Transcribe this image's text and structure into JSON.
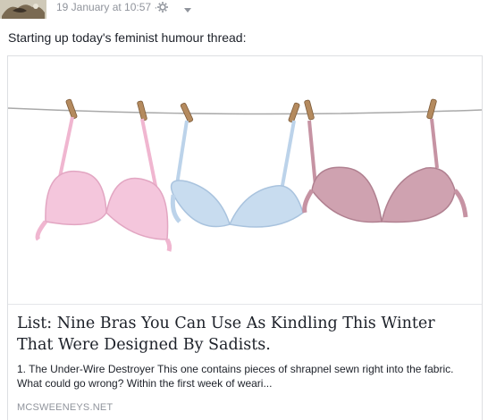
{
  "post": {
    "timestamp": "19 January at 10:57 ·",
    "text": "Starting up today's feminist humour thread:",
    "privacy_icon": "gear-icon",
    "menu_icon": "chevron-down-icon"
  },
  "link_card": {
    "image_description_icon": "bras-on-clothesline-image",
    "title": "List: Nine Bras You Can Use As Kindling This Winter That Were Designed By Sadists.",
    "description": "1. The Under-Wire Destroyer This one contains pieces of shrapnel sewn right into the fabric. What could go wrong? Within the first week of weari...",
    "domain": "MCSWEENEYS.NET"
  },
  "colors": {
    "meta_text": "#90949c",
    "body_text": "#1d2129",
    "card_border": "#dddfe2",
    "bra_pink": "#f4c6dc",
    "bra_blue": "#c8dcef",
    "bra_mauve": "#cfa2b0",
    "clothespin": "#b48a5e"
  }
}
